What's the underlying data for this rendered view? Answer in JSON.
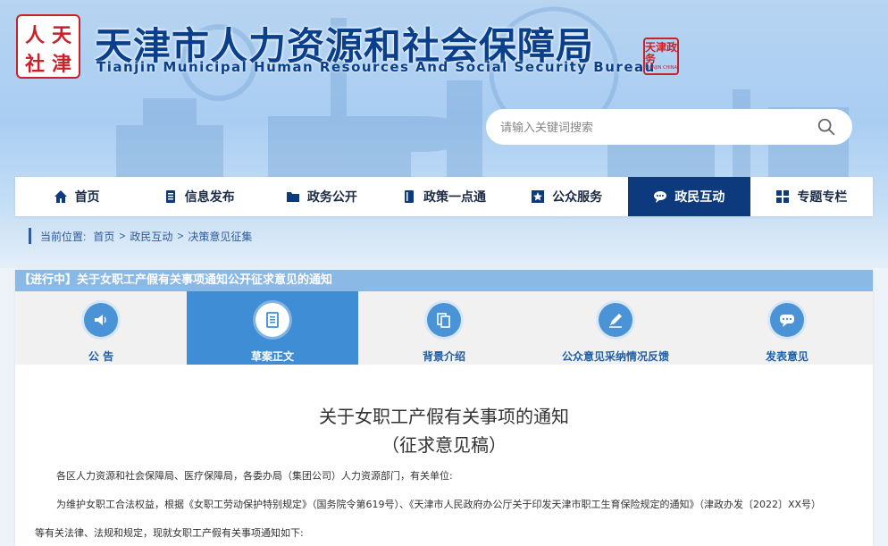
{
  "header": {
    "logo_chars": [
      "人",
      "天",
      "社",
      "津"
    ],
    "title": "天津市人力资源和社会保障局",
    "subtitle": "Tianjin Municipal Human Resources And Social Security Bureau",
    "emblem_text": "天津政务",
    "emblem_sub": "TIANJIN CHINA"
  },
  "search": {
    "placeholder": "请输入关键词搜索"
  },
  "nav": {
    "items": [
      {
        "label": "首页",
        "icon": "home-icon"
      },
      {
        "label": "信息发布",
        "icon": "document-icon"
      },
      {
        "label": "政务公开",
        "icon": "folder-icon"
      },
      {
        "label": "政策一点通",
        "icon": "book-icon"
      },
      {
        "label": "公众服务",
        "icon": "star-icon"
      },
      {
        "label": "政民互动",
        "icon": "chat-icon"
      },
      {
        "label": "专题专栏",
        "icon": "grid-icon"
      }
    ],
    "active_index": 5
  },
  "breadcrumb": {
    "prefix": "当前位置:",
    "items": [
      "首页",
      "政民互动",
      "决策意见征集"
    ]
  },
  "panel": {
    "heading": "【进行中】关于女职工产假有关事项通知公开征求意见的通知",
    "tabs": [
      {
        "label": "公  告",
        "icon": "speaker-icon"
      },
      {
        "label": "草案正文",
        "icon": "document-icon"
      },
      {
        "label": "背景介绍",
        "icon": "files-icon"
      },
      {
        "label": "公众意见采纳情况反馈",
        "icon": "pen-icon"
      },
      {
        "label": "发表意见",
        "icon": "comment-icon"
      }
    ],
    "active_tab": 1
  },
  "doc": {
    "title": "关于女职工产假有关事项的通知",
    "subtitle": "（征求意见稿）",
    "p1": "各区人力资源和社会保障局、医疗保障局，各委办局（集团公司）人力资源部门，有关单位:",
    "p2": "为维护女职工合法权益，根据《女职工劳动保护特别规定》（国务院令第619号）、《天津市人民政府办公厅关于印发天津市职工生育保险规定的通知》（津政办发〔2022〕XX号）",
    "p3": "等有关法律、法规和规定，现就女职工产假有关事项通知如下:"
  },
  "colors": {
    "nav_active": "#0d3a7c",
    "tab_active": "#3f8dd4",
    "panel_head": "#8bb9e5",
    "title_blue": "#0a3f8c",
    "logo_red": "#c8212a"
  }
}
